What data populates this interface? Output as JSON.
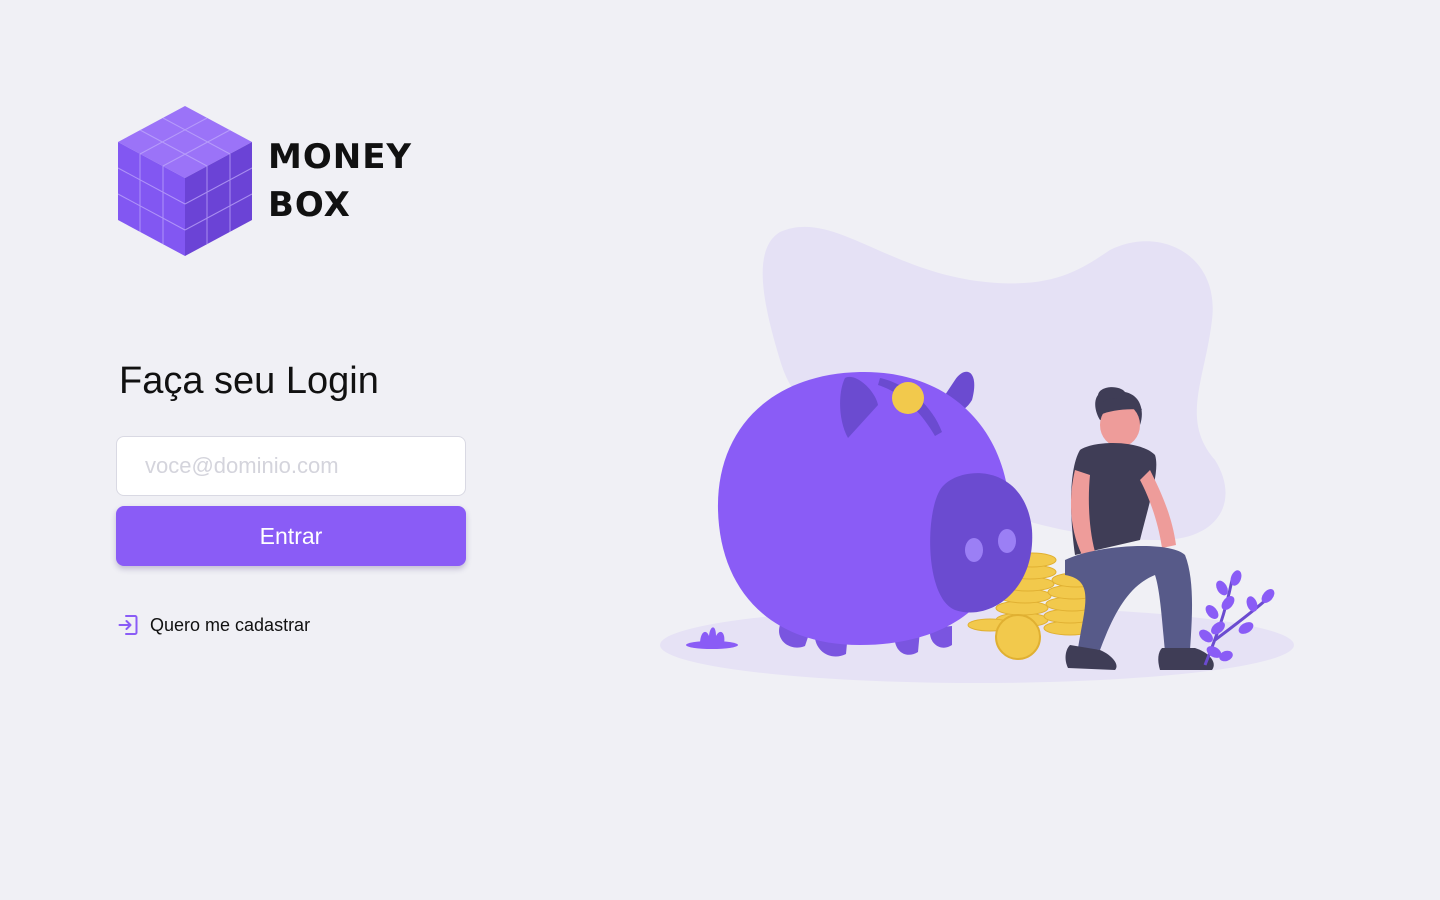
{
  "brand": {
    "line1": "MONEY",
    "line2": "BOX",
    "accent_color": "#8a5cf6"
  },
  "login": {
    "title": "Faça seu Login",
    "email_placeholder": "voce@dominio.com",
    "email_value": "",
    "submit_label": "Entrar",
    "register_label": "Quero me cadastrar",
    "register_icon": "sign-in-icon"
  },
  "illustration": {
    "subject": "piggy-bank-with-coins-and-person"
  }
}
